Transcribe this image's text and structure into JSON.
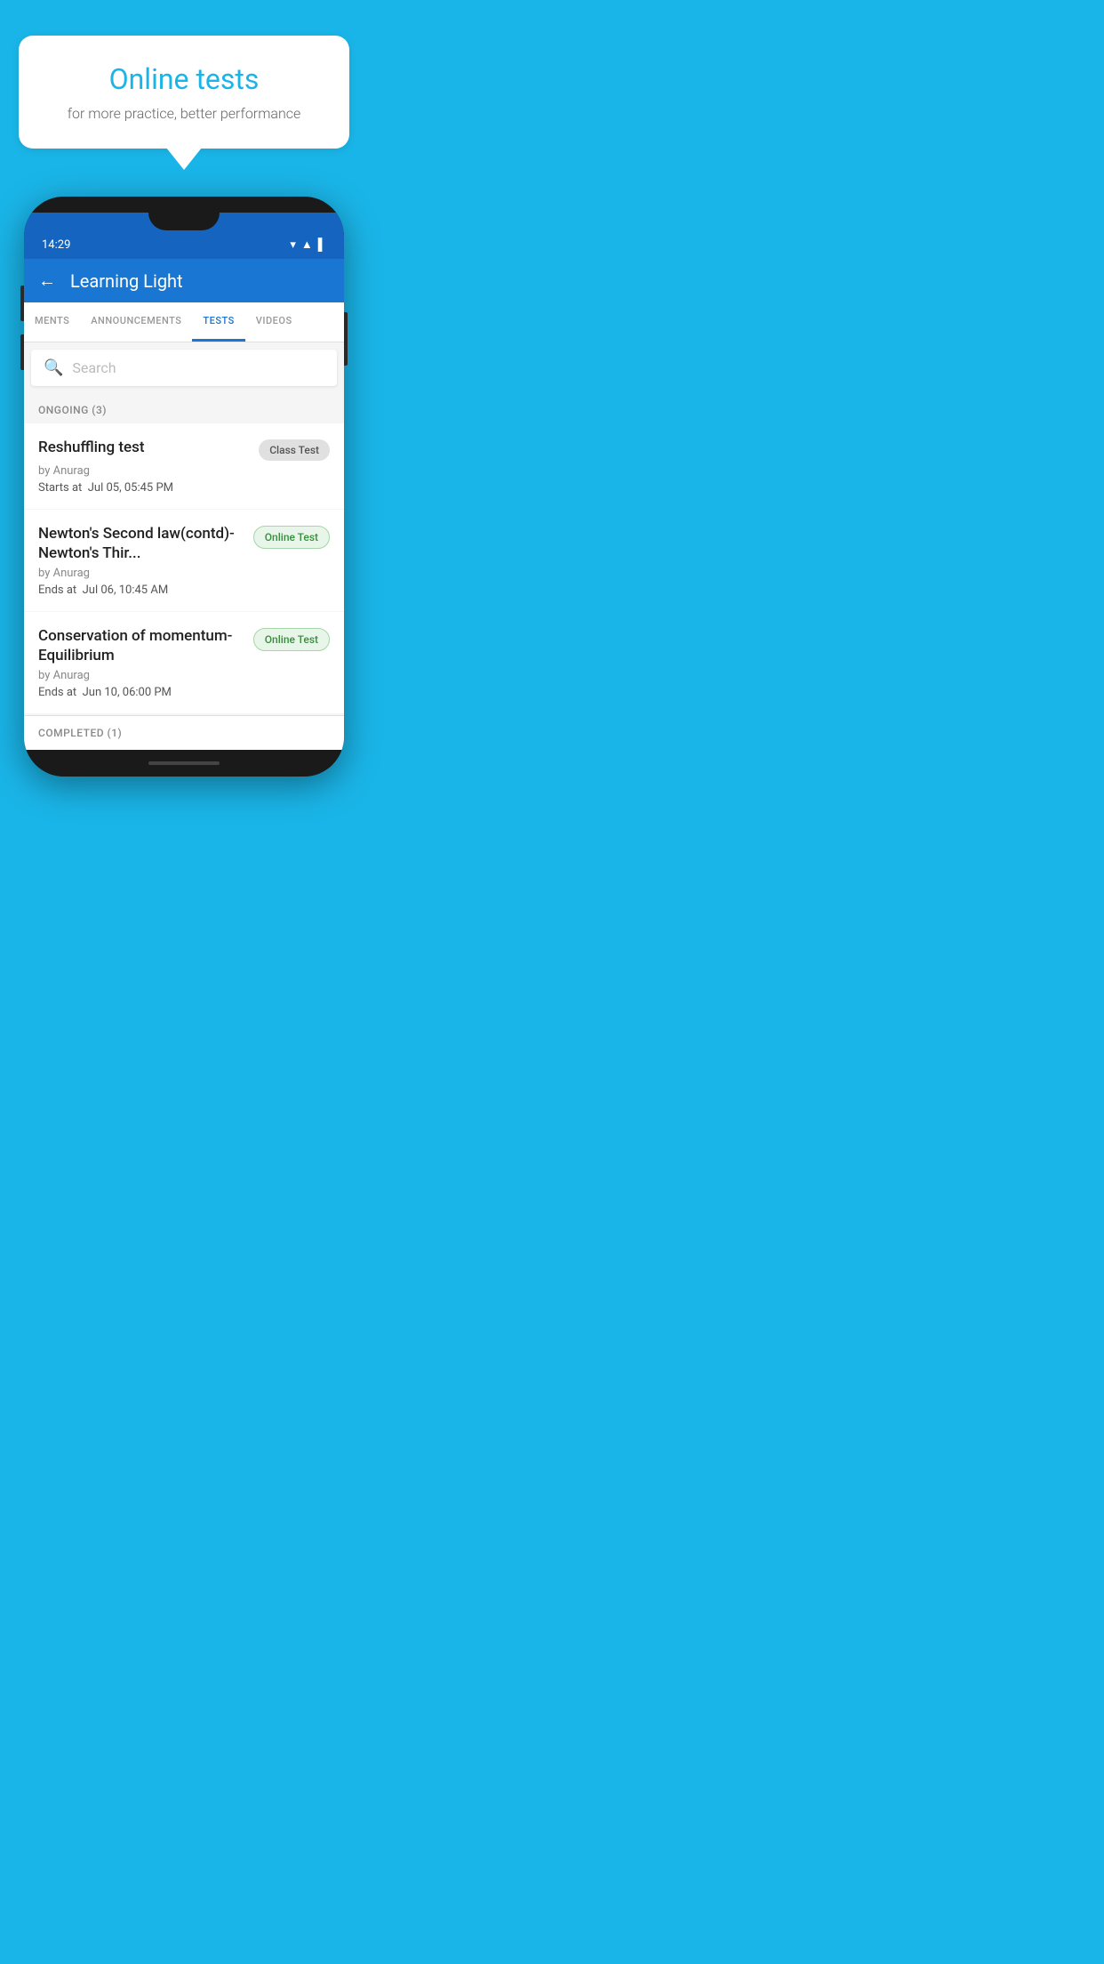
{
  "background_color": "#1ab5e8",
  "speech_bubble": {
    "title": "Online tests",
    "subtitle": "for more practice, better performance"
  },
  "phone": {
    "status_bar": {
      "time": "14:29",
      "icons": [
        "wifi",
        "signal",
        "battery"
      ]
    },
    "app_bar": {
      "title": "Learning Light",
      "back_label": "←"
    },
    "tabs": [
      {
        "label": "MENTS",
        "active": false
      },
      {
        "label": "ANNOUNCEMENTS",
        "active": false
      },
      {
        "label": "TESTS",
        "active": true
      },
      {
        "label": "VIDEOS",
        "active": false
      }
    ],
    "search": {
      "placeholder": "Search"
    },
    "ongoing_section": {
      "label": "ONGOING (3)",
      "tests": [
        {
          "title": "Reshuffling test",
          "badge": "Class Test",
          "badge_type": "class",
          "author": "by Anurag",
          "date_label": "Starts at",
          "date_value": "Jul 05, 05:45 PM"
        },
        {
          "title": "Newton's Second law(contd)-Newton's Thir...",
          "badge": "Online Test",
          "badge_type": "online",
          "author": "by Anurag",
          "date_label": "Ends at",
          "date_value": "Jul 06, 10:45 AM"
        },
        {
          "title": "Conservation of momentum-Equilibrium",
          "badge": "Online Test",
          "badge_type": "online",
          "author": "by Anurag",
          "date_label": "Ends at",
          "date_value": "Jun 10, 06:00 PM"
        }
      ]
    },
    "completed_section": {
      "label": "COMPLETED (1)"
    }
  }
}
